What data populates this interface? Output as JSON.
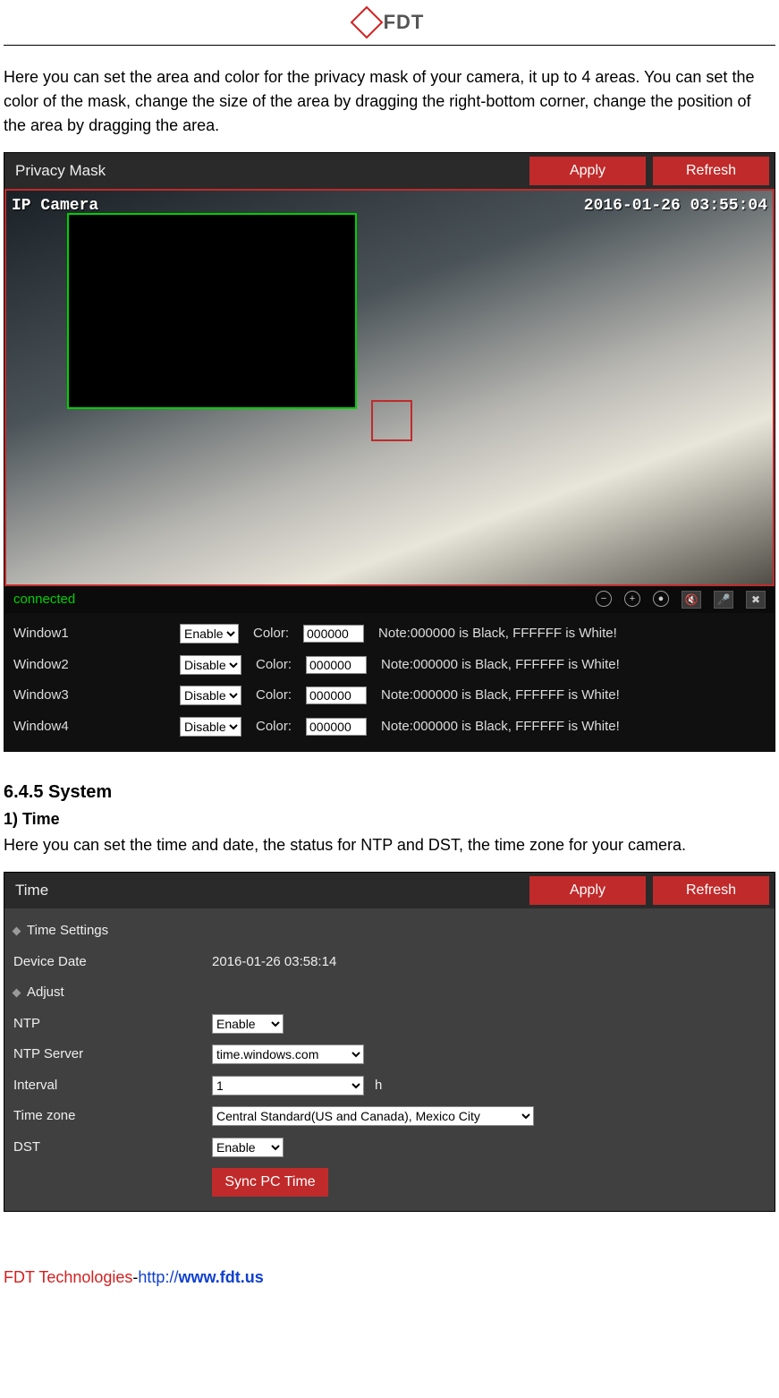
{
  "header": {
    "brand": "FDT"
  },
  "intro": "Here you can set the area and color for the privacy mask of your camera, it up to 4 areas. You can set the color of the mask, change the size of the area by dragging the right-bottom corner, change the position of the area by dragging the area.",
  "privacy_panel": {
    "title": "Privacy Mask",
    "apply": "Apply",
    "refresh": "Refresh",
    "video": {
      "ip_label": "IP Camera",
      "timestamp": "2016-01-26 03:55:04",
      "status": "connected"
    },
    "color_label": "Color:",
    "note": "Note:000000 is Black, FFFFFF is White!",
    "windows": [
      {
        "name": "Window1",
        "enable": "Enable",
        "color": "000000"
      },
      {
        "name": "Window2",
        "enable": "Disable",
        "color": "000000"
      },
      {
        "name": "Window3",
        "enable": "Disable",
        "color": "000000"
      },
      {
        "name": "Window4",
        "enable": "Disable",
        "color": "000000"
      }
    ]
  },
  "section_system": {
    "heading": "6.4.5 System",
    "sub": "1) Time",
    "desc": "Here you can set the time and date, the status for NTP and DST, the time zone for your camera."
  },
  "time_panel": {
    "title": "Time",
    "apply": "Apply",
    "refresh": "Refresh",
    "group_settings": "Time Settings",
    "device_date_label": "Device Date",
    "device_date_value": "2016-01-26 03:58:14",
    "group_adjust": "Adjust",
    "ntp_label": "NTP",
    "ntp_value": "Enable",
    "ntp_server_label": "NTP Server",
    "ntp_server_value": "time.windows.com",
    "interval_label": "Interval",
    "interval_value": "1",
    "interval_unit": "h",
    "tz_label": "Time zone",
    "tz_value": "Central Standard(US and Canada), Mexico City",
    "dst_label": "DST",
    "dst_value": "Enable",
    "sync_btn": "Sync PC Time"
  },
  "footer": {
    "company": "FDT Technologies",
    "sep": "-",
    "proto": "http://",
    "domain": "www.fdt.us"
  }
}
